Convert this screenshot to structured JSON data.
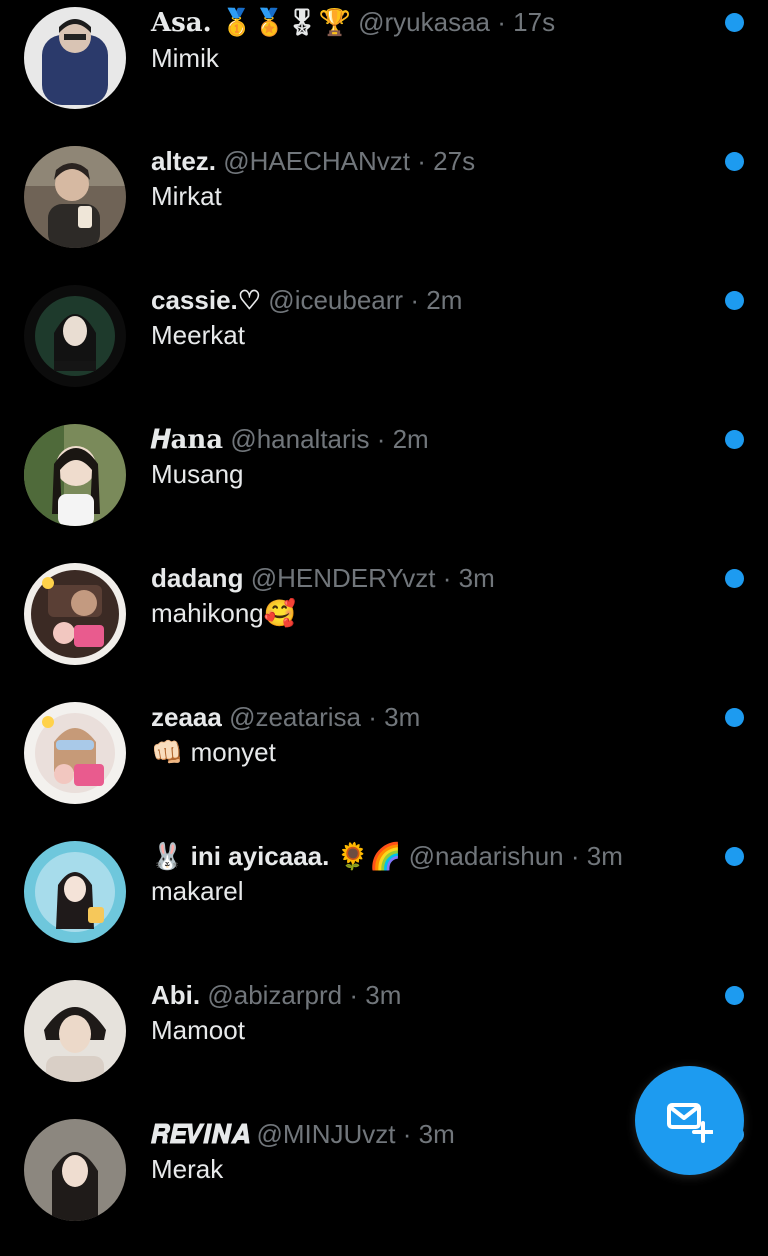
{
  "accent_color": "#1d9bf0",
  "messages": [
    {
      "name": "Asa. 🥇🏅🎖🏆",
      "handle": "@ryukasaa",
      "separator": "·",
      "time": "17s",
      "preview": "Mimik",
      "unread": true
    },
    {
      "name": "altez.",
      "handle": "@HAECHANvzt",
      "separator": "·",
      "time": "27s",
      "preview": "Mirkat",
      "unread": true
    },
    {
      "name": "cassie.♡",
      "handle": "@iceubearr",
      "separator": "·",
      "time": "2m",
      "preview": "Meerkat",
      "unread": true
    },
    {
      "name": "𝑯ana",
      "handle": "@hanaltaris",
      "separator": "·",
      "time": "2m",
      "preview": "Musang",
      "unread": true
    },
    {
      "name": "dadang",
      "handle": "@HENDERYvzt",
      "separator": "·",
      "time": "3m",
      "preview": "mahikong🥰",
      "unread": true
    },
    {
      "name": "zeaaa",
      "handle": "@zeatarisa",
      "separator": "·",
      "time": "3m",
      "preview": "👊🏻 monyet",
      "unread": true
    },
    {
      "name": "🐰 ini ayicaaa. 🌻🌈",
      "handle": "@nadarishun",
      "separator": "·",
      "time": "3m",
      "preview": "makarel",
      "unread": true
    },
    {
      "name": "Abi.",
      "handle": "@abizarprd",
      "separator": "·",
      "time": "3m",
      "preview": "Mamoot",
      "unread": true
    },
    {
      "name": "𝑹𝑬𝑽𝑰𝑵𝑨",
      "handle": "@MINJUvzt",
      "separator": "·",
      "time": "3m",
      "preview": "Merak",
      "unread": true
    }
  ],
  "fab": {
    "icon": "new-message-icon"
  }
}
